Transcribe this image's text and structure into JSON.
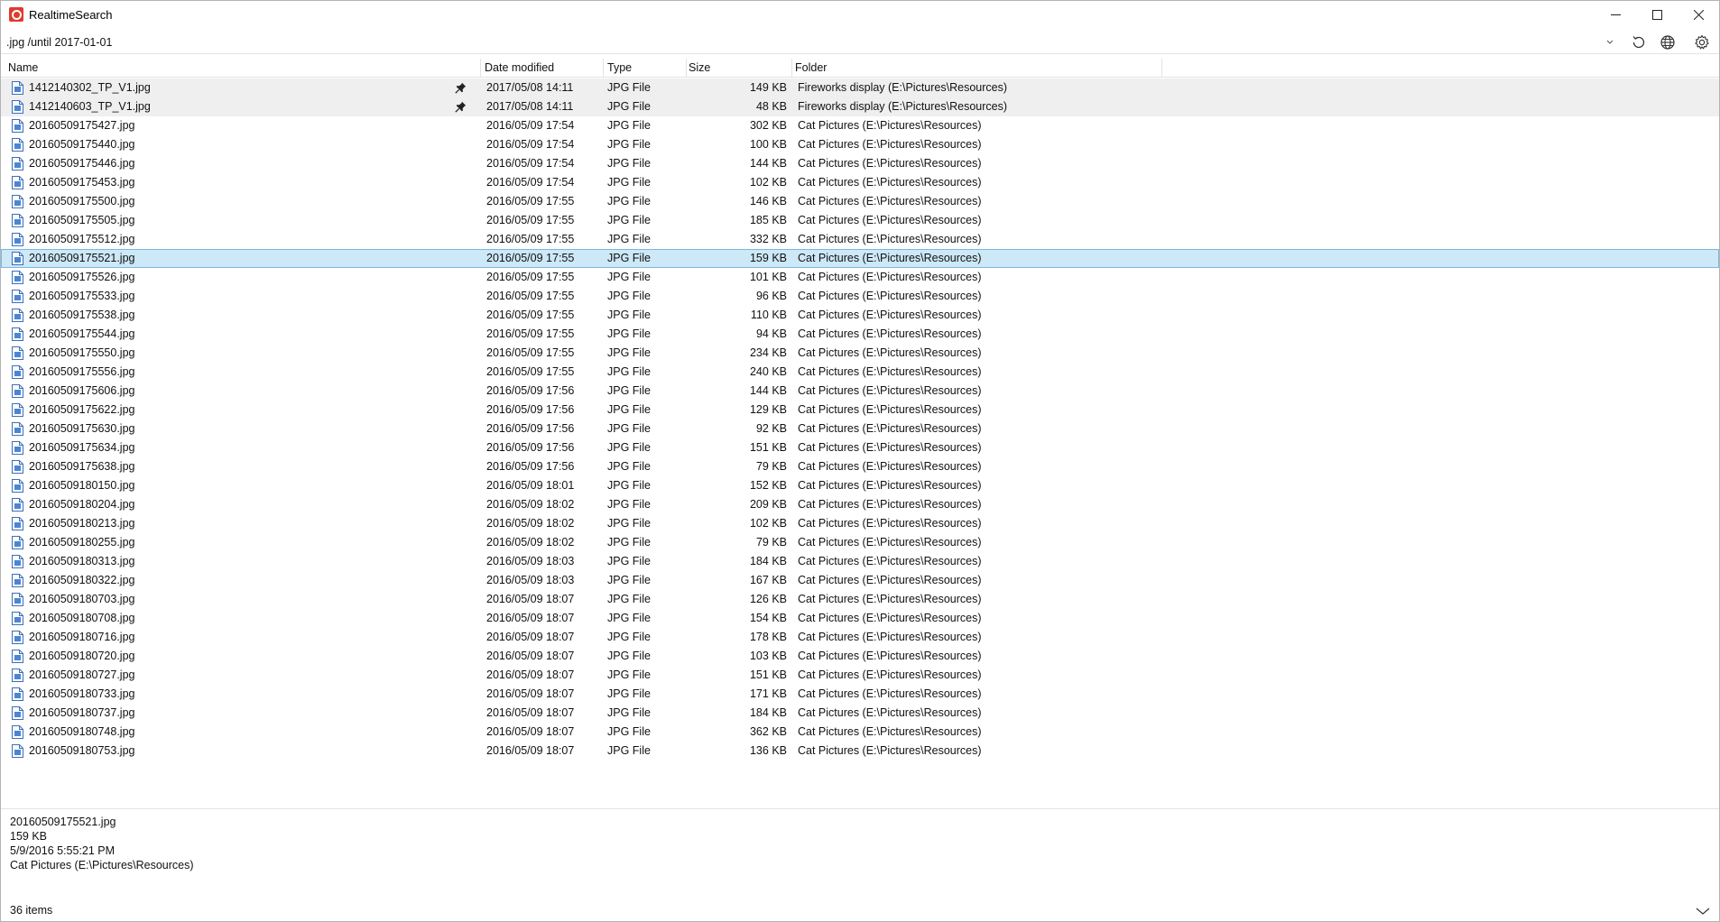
{
  "window": {
    "title": "RealtimeSearch"
  },
  "search": {
    "value": ".jpg /until 2017-01-01"
  },
  "toolbar": {
    "dropdown_icon": "chevron-down-icon",
    "refresh_icon": "refresh-icon",
    "web_icon": "globe-icon",
    "settings_icon": "gear-icon"
  },
  "columns": {
    "name": "Name",
    "date": "Date modified",
    "type": "Type",
    "size": "Size",
    "folder": "Folder"
  },
  "rows": [
    {
      "name": "1412140302_TP_V1.jpg",
      "date": "2017/05/08 14:11",
      "type": "JPG File",
      "size": "149 KB",
      "folder": "Fireworks display (E:\\Pictures\\Resources)",
      "pinned": true
    },
    {
      "name": "1412140603_TP_V1.jpg",
      "date": "2017/05/08 14:11",
      "type": "JPG File",
      "size": "48 KB",
      "folder": "Fireworks display (E:\\Pictures\\Resources)",
      "pinned": true
    },
    {
      "name": "20160509175427.jpg",
      "date": "2016/05/09 17:54",
      "type": "JPG File",
      "size": "302 KB",
      "folder": "Cat Pictures (E:\\Pictures\\Resources)"
    },
    {
      "name": "20160509175440.jpg",
      "date": "2016/05/09 17:54",
      "type": "JPG File",
      "size": "100 KB",
      "folder": "Cat Pictures (E:\\Pictures\\Resources)"
    },
    {
      "name": "20160509175446.jpg",
      "date": "2016/05/09 17:54",
      "type": "JPG File",
      "size": "144 KB",
      "folder": "Cat Pictures (E:\\Pictures\\Resources)"
    },
    {
      "name": "20160509175453.jpg",
      "date": "2016/05/09 17:54",
      "type": "JPG File",
      "size": "102 KB",
      "folder": "Cat Pictures (E:\\Pictures\\Resources)"
    },
    {
      "name": "20160509175500.jpg",
      "date": "2016/05/09 17:55",
      "type": "JPG File",
      "size": "146 KB",
      "folder": "Cat Pictures (E:\\Pictures\\Resources)"
    },
    {
      "name": "20160509175505.jpg",
      "date": "2016/05/09 17:55",
      "type": "JPG File",
      "size": "185 KB",
      "folder": "Cat Pictures (E:\\Pictures\\Resources)"
    },
    {
      "name": "20160509175512.jpg",
      "date": "2016/05/09 17:55",
      "type": "JPG File",
      "size": "332 KB",
      "folder": "Cat Pictures (E:\\Pictures\\Resources)"
    },
    {
      "name": "20160509175521.jpg",
      "date": "2016/05/09 17:55",
      "type": "JPG File",
      "size": "159 KB",
      "folder": "Cat Pictures (E:\\Pictures\\Resources)",
      "selected": true
    },
    {
      "name": "20160509175526.jpg",
      "date": "2016/05/09 17:55",
      "type": "JPG File",
      "size": "101 KB",
      "folder": "Cat Pictures (E:\\Pictures\\Resources)"
    },
    {
      "name": "20160509175533.jpg",
      "date": "2016/05/09 17:55",
      "type": "JPG File",
      "size": "96 KB",
      "folder": "Cat Pictures (E:\\Pictures\\Resources)"
    },
    {
      "name": "20160509175538.jpg",
      "date": "2016/05/09 17:55",
      "type": "JPG File",
      "size": "110 KB",
      "folder": "Cat Pictures (E:\\Pictures\\Resources)"
    },
    {
      "name": "20160509175544.jpg",
      "date": "2016/05/09 17:55",
      "type": "JPG File",
      "size": "94 KB",
      "folder": "Cat Pictures (E:\\Pictures\\Resources)"
    },
    {
      "name": "20160509175550.jpg",
      "date": "2016/05/09 17:55",
      "type": "JPG File",
      "size": "234 KB",
      "folder": "Cat Pictures (E:\\Pictures\\Resources)"
    },
    {
      "name": "20160509175556.jpg",
      "date": "2016/05/09 17:55",
      "type": "JPG File",
      "size": "240 KB",
      "folder": "Cat Pictures (E:\\Pictures\\Resources)"
    },
    {
      "name": "20160509175606.jpg",
      "date": "2016/05/09 17:56",
      "type": "JPG File",
      "size": "144 KB",
      "folder": "Cat Pictures (E:\\Pictures\\Resources)"
    },
    {
      "name": "20160509175622.jpg",
      "date": "2016/05/09 17:56",
      "type": "JPG File",
      "size": "129 KB",
      "folder": "Cat Pictures (E:\\Pictures\\Resources)"
    },
    {
      "name": "20160509175630.jpg",
      "date": "2016/05/09 17:56",
      "type": "JPG File",
      "size": "92 KB",
      "folder": "Cat Pictures (E:\\Pictures\\Resources)"
    },
    {
      "name": "20160509175634.jpg",
      "date": "2016/05/09 17:56",
      "type": "JPG File",
      "size": "151 KB",
      "folder": "Cat Pictures (E:\\Pictures\\Resources)"
    },
    {
      "name": "20160509175638.jpg",
      "date": "2016/05/09 17:56",
      "type": "JPG File",
      "size": "79 KB",
      "folder": "Cat Pictures (E:\\Pictures\\Resources)"
    },
    {
      "name": "20160509180150.jpg",
      "date": "2016/05/09 18:01",
      "type": "JPG File",
      "size": "152 KB",
      "folder": "Cat Pictures (E:\\Pictures\\Resources)"
    },
    {
      "name": "20160509180204.jpg",
      "date": "2016/05/09 18:02",
      "type": "JPG File",
      "size": "209 KB",
      "folder": "Cat Pictures (E:\\Pictures\\Resources)"
    },
    {
      "name": "20160509180213.jpg",
      "date": "2016/05/09 18:02",
      "type": "JPG File",
      "size": "102 KB",
      "folder": "Cat Pictures (E:\\Pictures\\Resources)"
    },
    {
      "name": "20160509180255.jpg",
      "date": "2016/05/09 18:02",
      "type": "JPG File",
      "size": "79 KB",
      "folder": "Cat Pictures (E:\\Pictures\\Resources)"
    },
    {
      "name": "20160509180313.jpg",
      "date": "2016/05/09 18:03",
      "type": "JPG File",
      "size": "184 KB",
      "folder": "Cat Pictures (E:\\Pictures\\Resources)"
    },
    {
      "name": "20160509180322.jpg",
      "date": "2016/05/09 18:03",
      "type": "JPG File",
      "size": "167 KB",
      "folder": "Cat Pictures (E:\\Pictures\\Resources)"
    },
    {
      "name": "20160509180703.jpg",
      "date": "2016/05/09 18:07",
      "type": "JPG File",
      "size": "126 KB",
      "folder": "Cat Pictures (E:\\Pictures\\Resources)"
    },
    {
      "name": "20160509180708.jpg",
      "date": "2016/05/09 18:07",
      "type": "JPG File",
      "size": "154 KB",
      "folder": "Cat Pictures (E:\\Pictures\\Resources)"
    },
    {
      "name": "20160509180716.jpg",
      "date": "2016/05/09 18:07",
      "type": "JPG File",
      "size": "178 KB",
      "folder": "Cat Pictures (E:\\Pictures\\Resources)"
    },
    {
      "name": "20160509180720.jpg",
      "date": "2016/05/09 18:07",
      "type": "JPG File",
      "size": "103 KB",
      "folder": "Cat Pictures (E:\\Pictures\\Resources)"
    },
    {
      "name": "20160509180727.jpg",
      "date": "2016/05/09 18:07",
      "type": "JPG File",
      "size": "151 KB",
      "folder": "Cat Pictures (E:\\Pictures\\Resources)"
    },
    {
      "name": "20160509180733.jpg",
      "date": "2016/05/09 18:07",
      "type": "JPG File",
      "size": "171 KB",
      "folder": "Cat Pictures (E:\\Pictures\\Resources)"
    },
    {
      "name": "20160509180737.jpg",
      "date": "2016/05/09 18:07",
      "type": "JPG File",
      "size": "184 KB",
      "folder": "Cat Pictures (E:\\Pictures\\Resources)"
    },
    {
      "name": "20160509180748.jpg",
      "date": "2016/05/09 18:07",
      "type": "JPG File",
      "size": "362 KB",
      "folder": "Cat Pictures (E:\\Pictures\\Resources)"
    },
    {
      "name": "20160509180753.jpg",
      "date": "2016/05/09 18:07",
      "type": "JPG File",
      "size": "136 KB",
      "folder": "Cat Pictures (E:\\Pictures\\Resources)"
    }
  ],
  "details": {
    "name": "20160509175521.jpg",
    "size": "159 KB",
    "modified": "5/9/2016 5:55:21 PM",
    "folder": "Cat Pictures (E:\\Pictures\\Resources)"
  },
  "status": {
    "count": "36 items"
  },
  "colors": {
    "selected_bg": "#cde8f7",
    "pinned_bg": "#efefef",
    "app_icon": "#e03a2e"
  }
}
